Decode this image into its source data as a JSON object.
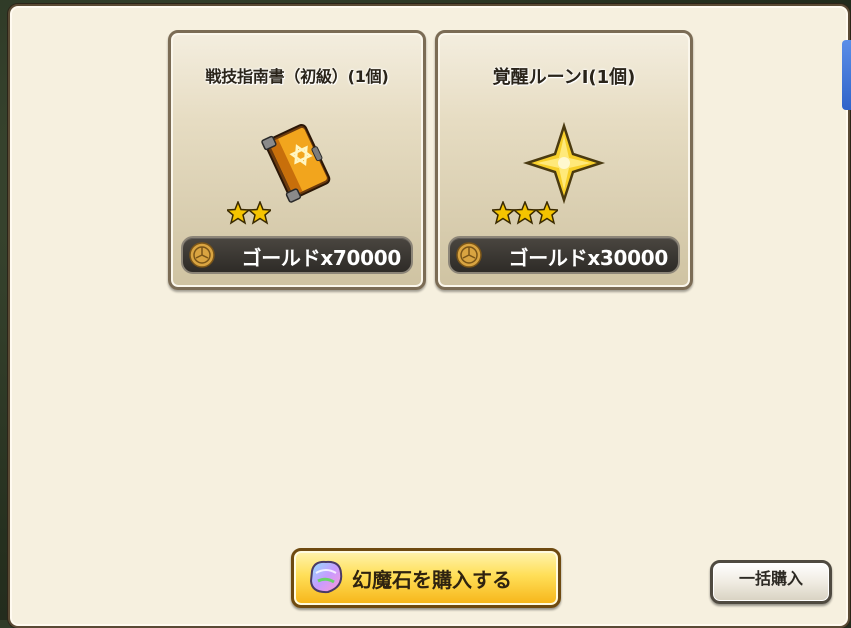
{
  "items": [
    {
      "name": "戦技指南書（初級）(1個)",
      "stars": 2,
      "icon": "tome-icon",
      "price": "ゴールドx70000"
    },
    {
      "name": "覚醒ルーンⅠ(1個)",
      "stars": 3,
      "icon": "rune-crystal-icon",
      "price": "ゴールドx30000"
    }
  ],
  "buttons": {
    "buy_gems": "幻魔石を購入する",
    "bulk_buy": "一括購入"
  },
  "colors": {
    "panel_bg": "#f6f0df",
    "price_bar": "#2e2b27",
    "buy_button": "#ffdf58",
    "star": "#f5c400"
  }
}
